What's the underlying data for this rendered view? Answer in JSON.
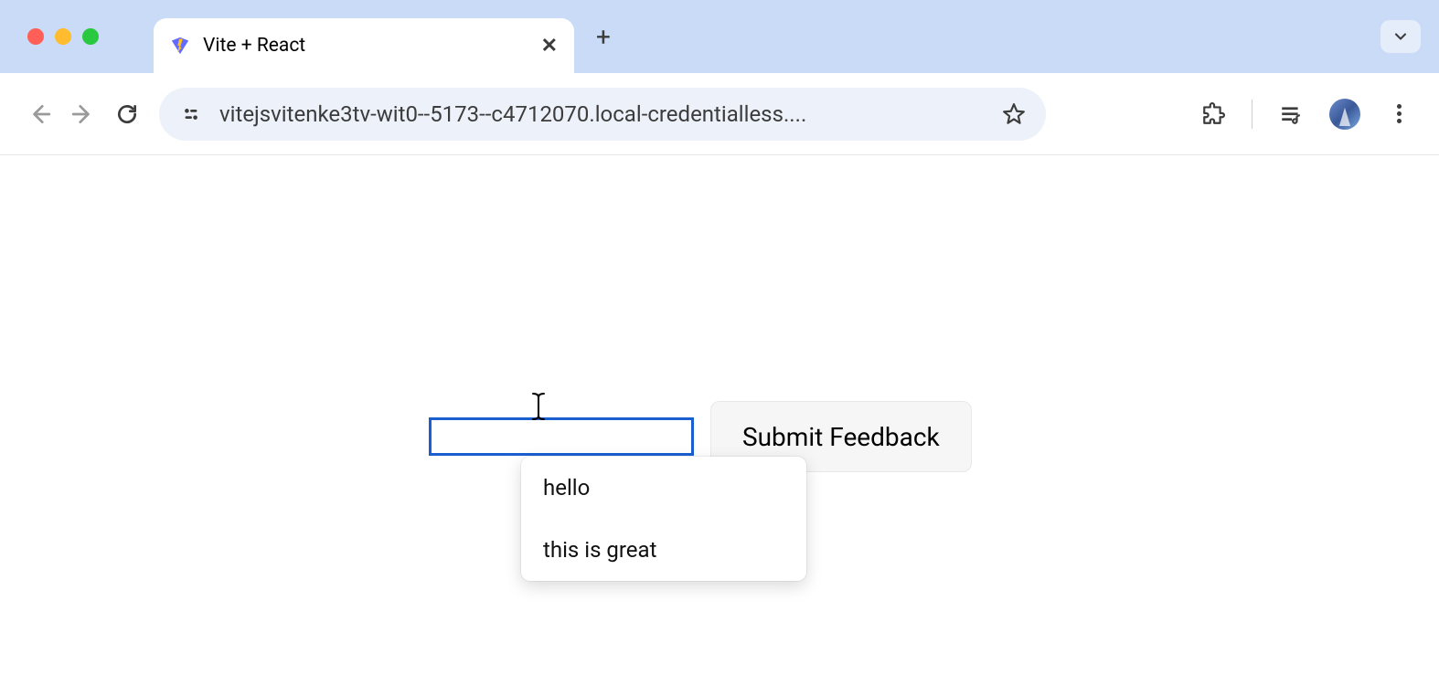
{
  "browser": {
    "tab": {
      "title": "Vite + React"
    },
    "url": "vitejsvitenke3tv-wit0--5173--c4712070.local-credentialless...."
  },
  "form": {
    "input_value": "",
    "submit_label": "Submit Feedback"
  },
  "suggestions": [
    {
      "label": "hello"
    },
    {
      "label": "this is great"
    }
  ]
}
